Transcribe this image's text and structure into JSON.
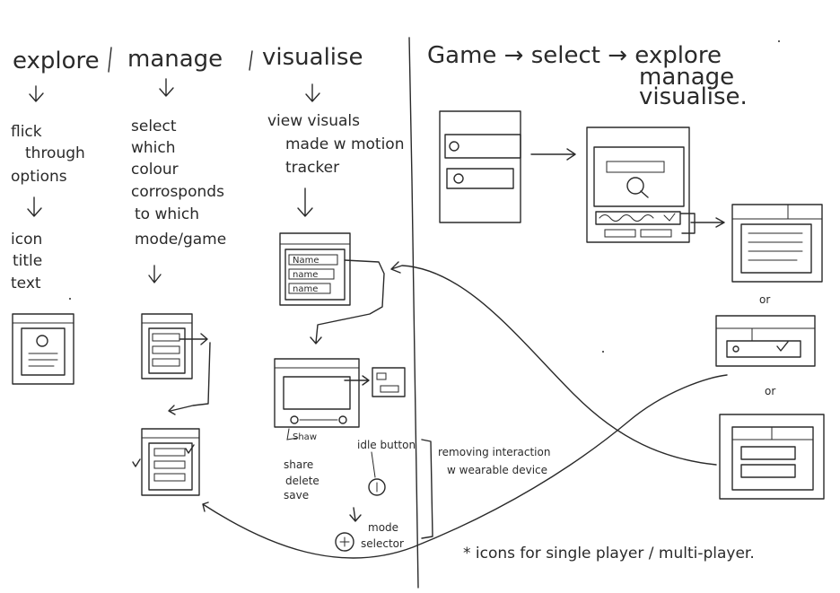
{
  "columns": {
    "explore": {
      "title": "explore",
      "steps": [
        "flick",
        "through",
        "options"
      ],
      "content": [
        "icon",
        "title",
        "text"
      ]
    },
    "manage": {
      "title": "manage",
      "steps": [
        "select",
        "which",
        "colour",
        "corrosponds",
        "to which",
        "mode/game"
      ]
    },
    "visualise": {
      "title": "visualise",
      "steps": [
        "view visuals",
        "made w motion",
        "tracker"
      ],
      "list_items": [
        "Name",
        "name",
        "name"
      ],
      "share_options": [
        "share",
        "delete",
        "save"
      ],
      "shaw_label": "Shaw"
    }
  },
  "flow": {
    "header_line1": "Game → select → explore",
    "header_line2": "manage",
    "header_line3": "visualise.",
    "or_labels": [
      "or",
      "or"
    ]
  },
  "annotations": {
    "idle_button": "idle button",
    "mode_selector_line1": "mode",
    "mode_selector_line2": "selector",
    "removing_line1": "removing interaction",
    "removing_line2": "w wearable device",
    "icons_note": "* icons for single player / multi-player."
  }
}
